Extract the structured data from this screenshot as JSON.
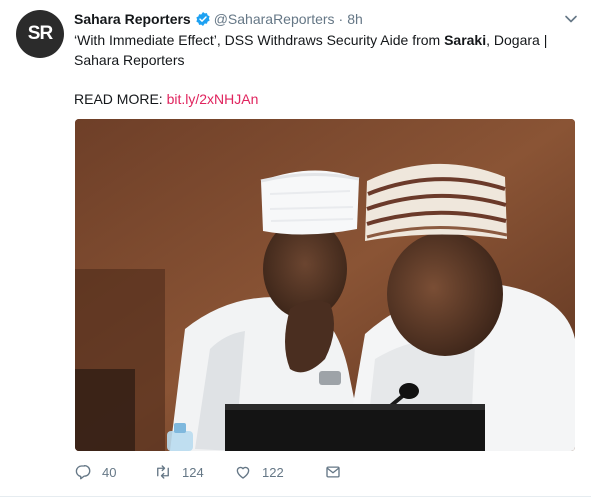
{
  "tweet": {
    "avatar_text_main": "SR",
    "name": "Sahara Reporters",
    "handle": "@SaharaReporters",
    "separator": "·",
    "time": "8h",
    "text_part1": "‘With Immediate Effect’, DSS Withdraws Security Aide from ",
    "text_bold": "Saraki",
    "text_part2": ", Dogara | Sahara Reporters",
    "readmore_label": "READ MORE: ",
    "readmore_link": "bit.ly/2xNHJAn",
    "image_alt": "Photo of two men in white caps conversing"
  },
  "actions": {
    "reply_count": "40",
    "retweet_count": "124",
    "like_count": "122"
  },
  "icons": {
    "verified": "verified-badge-icon",
    "caret": "chevron-down-icon",
    "reply": "reply-icon",
    "retweet": "retweet-icon",
    "like": "heart-icon",
    "dm": "envelope-icon"
  },
  "colors": {
    "link": "#e0245e",
    "verified": "#1da1f2",
    "muted": "#657786",
    "avatar_bg": "#2b2b2b",
    "avatar_accent": "#e63a2e"
  }
}
